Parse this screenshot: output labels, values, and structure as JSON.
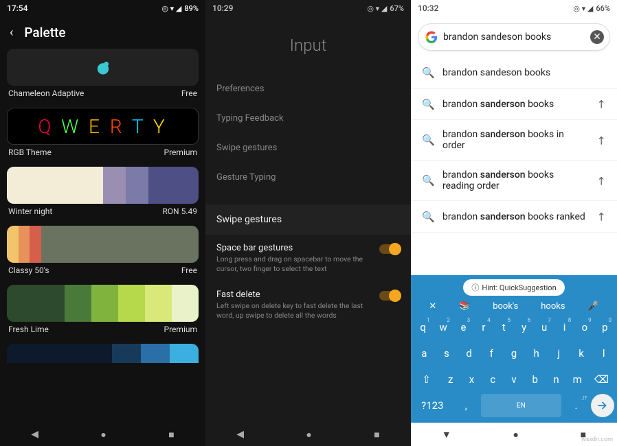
{
  "pane1": {
    "status_time": "17:54",
    "status_battery": "89%",
    "title": "Palette",
    "themes": [
      {
        "name": "Chameleon Adaptive",
        "price": "Free"
      },
      {
        "name": "RGB Theme",
        "price": "Premium"
      },
      {
        "name": "Winter night",
        "price": "RON 5.49"
      },
      {
        "name": "Classy 50's",
        "price": "Free"
      },
      {
        "name": "Fresh Lime",
        "price": "Premium"
      }
    ]
  },
  "pane2": {
    "status_time": "10:29",
    "status_battery": "67%",
    "title": "Input",
    "menu": [
      "Preferences",
      "Typing Feedback",
      "Swipe gestures",
      "Gesture Typing"
    ],
    "section": "Swipe gestures",
    "toggles": [
      {
        "title": "Space bar gestures",
        "desc": "Long press and drag on spacebar to move the cursor, two finger to select the text",
        "on": true
      },
      {
        "title": "Fast delete",
        "desc": "Left swipe on delete key to fast delete the last word, up swipe to delete all the words",
        "on": true
      }
    ]
  },
  "pane3": {
    "status_time": "10:32",
    "status_battery": "66%",
    "search_query": "brandon sandeson books",
    "suggestions": [
      {
        "plain": "brandon sandeson books",
        "bold": "",
        "tail": "",
        "arrow": false
      },
      {
        "plain": "brandon ",
        "bold": "sanderson",
        "tail": " books",
        "arrow": true
      },
      {
        "plain": "brandon ",
        "bold": "sanderson",
        "tail": " books in order",
        "arrow": true
      },
      {
        "plain": "brandon ",
        "bold": "sanderson",
        "tail": " books reading order",
        "arrow": true
      },
      {
        "plain": "brandon ",
        "bold": "sanderson",
        "tail": " books ranked",
        "arrow": true
      }
    ],
    "keyboard": {
      "hint": "Hint: QuickSuggestion",
      "sugg": [
        "book's",
        "hooks"
      ],
      "row1": [
        [
          "q",
          "1"
        ],
        [
          "w",
          "2"
        ],
        [
          "e",
          "3"
        ],
        [
          "r",
          "4"
        ],
        [
          "t",
          "5"
        ],
        [
          "y",
          "6"
        ],
        [
          "u",
          "7"
        ],
        [
          "i",
          "8"
        ],
        [
          "o",
          "9"
        ],
        [
          "p",
          "0"
        ]
      ],
      "row2": [
        "a",
        "s",
        "d",
        "f",
        "g",
        "h",
        "j",
        "k",
        "l"
      ],
      "row3": [
        "z",
        "x",
        "c",
        "v",
        "b",
        "n",
        "m"
      ],
      "sym": "?123",
      "space": "EN",
      "punct": ".!?"
    }
  },
  "watermark": "wsxdn.com"
}
